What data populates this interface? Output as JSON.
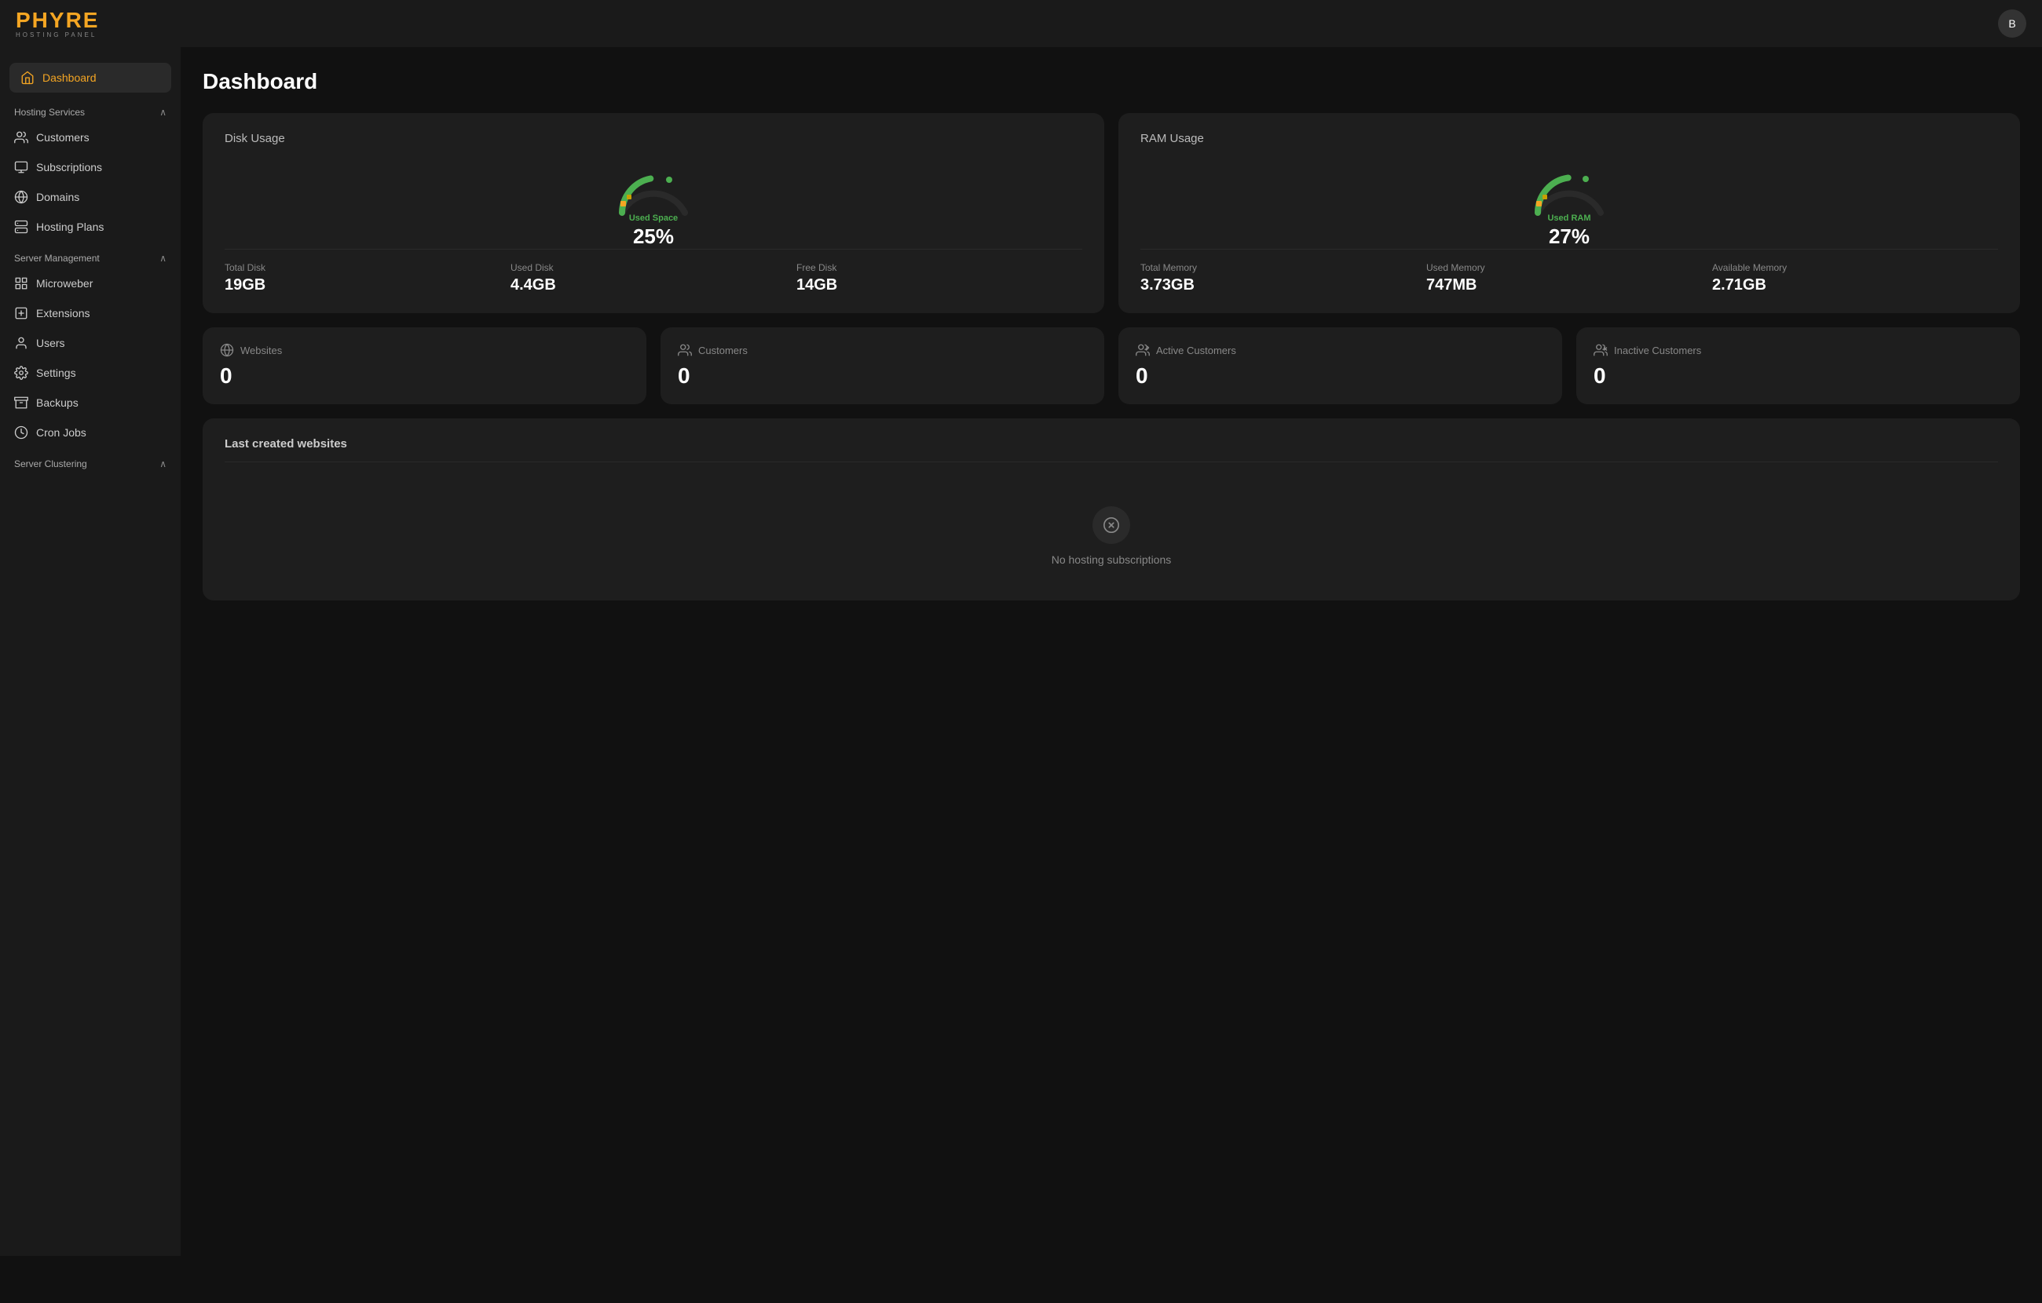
{
  "app": {
    "name": "PHYRE",
    "subtitle": "HOSTING PANEL",
    "user_initial": "B"
  },
  "sidebar": {
    "active_item": {
      "label": "Dashboard",
      "icon": "home-icon"
    },
    "sections": [
      {
        "title": "Hosting Services",
        "collapsible": true,
        "expanded": true,
        "items": [
          {
            "label": "Customers",
            "icon": "users-icon"
          },
          {
            "label": "Subscriptions",
            "icon": "tag-icon"
          },
          {
            "label": "Domains",
            "icon": "globe-icon"
          },
          {
            "label": "Hosting Plans",
            "icon": "server-icon"
          }
        ]
      },
      {
        "title": "Server Management",
        "collapsible": true,
        "expanded": true,
        "items": [
          {
            "label": "Microweber",
            "icon": "grid-icon"
          },
          {
            "label": "Extensions",
            "icon": "plus-square-icon"
          },
          {
            "label": "Users",
            "icon": "user-icon"
          },
          {
            "label": "Settings",
            "icon": "settings-icon"
          },
          {
            "label": "Backups",
            "icon": "archive-icon"
          },
          {
            "label": "Cron Jobs",
            "icon": "clock-icon"
          }
        ]
      },
      {
        "title": "Server Clustering",
        "collapsible": true,
        "expanded": true,
        "items": []
      }
    ]
  },
  "dashboard": {
    "title": "Dashboard",
    "disk_usage": {
      "card_title": "Disk Usage",
      "gauge_label": "Used Space",
      "percentage": "25%",
      "percentage_raw": 25,
      "stats": [
        {
          "label": "Total Disk",
          "value": "19GB"
        },
        {
          "label": "Used Disk",
          "value": "4.4GB"
        },
        {
          "label": "Free Disk",
          "value": "14GB"
        }
      ]
    },
    "ram_usage": {
      "card_title": "RAM Usage",
      "gauge_label": "Used RAM",
      "percentage": "27%",
      "percentage_raw": 27,
      "stats": [
        {
          "label": "Total Memory",
          "value": "3.73GB"
        },
        {
          "label": "Used Memory",
          "value": "747MB"
        },
        {
          "label": "Available Memory",
          "value": "2.71GB"
        }
      ]
    },
    "counters": [
      {
        "label": "Websites",
        "value": "0",
        "icon": "globe-icon"
      },
      {
        "label": "Customers",
        "value": "0",
        "icon": "users-icon"
      },
      {
        "label": "Active Customers",
        "value": "0",
        "icon": "users-active-icon"
      },
      {
        "label": "Inactive Customers",
        "value": "0",
        "icon": "users-inactive-icon"
      }
    ],
    "websites_section": {
      "title": "Last created websites",
      "empty_icon": "x-circle-icon",
      "empty_text": "No hosting subscriptions"
    }
  }
}
